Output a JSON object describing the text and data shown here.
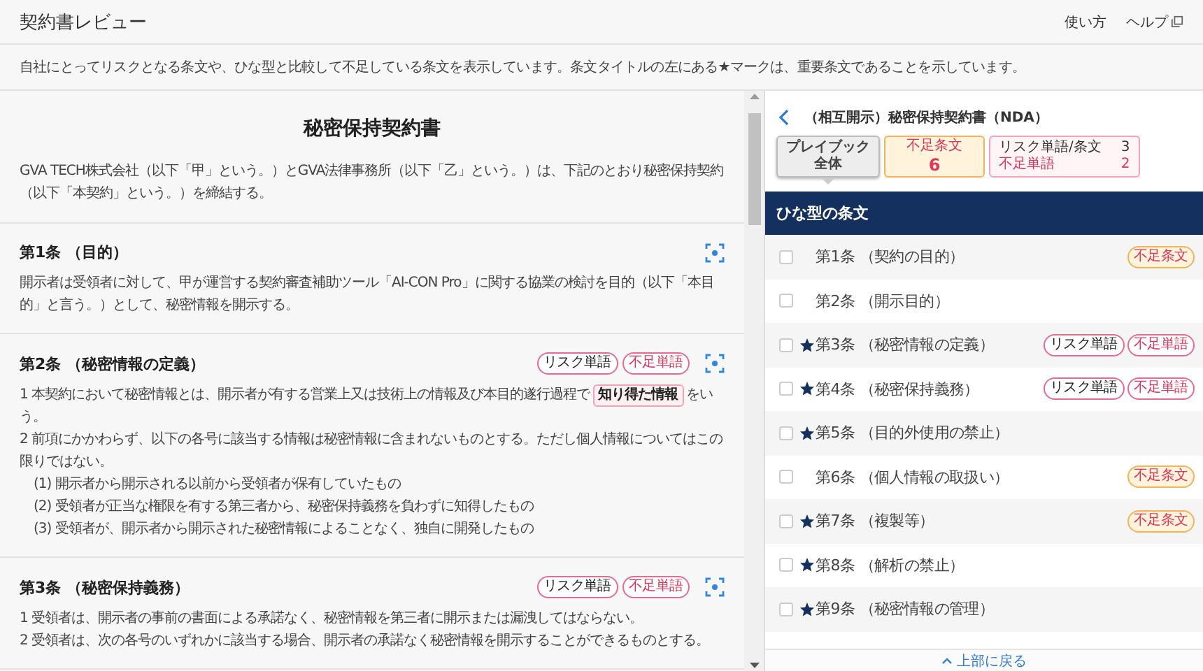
{
  "header": {
    "title": "契約書レビュー",
    "links": [
      {
        "label": "使い方",
        "external": false
      },
      {
        "label": "ヘルプ",
        "external": true
      }
    ]
  },
  "notice": "自社にとってリスクとなる条文や、ひな型と比較して不足している条文を表示しています。条文タイトルの左にある★マークは、重要条文であることを示しています。",
  "document": {
    "title": "秘密保持契約書",
    "preamble": "GVA TECH株式会社（以下「甲」という。）とGVA法律事務所（以下「乙」という。）は、下記のとおり秘密保持契約（以下「本契約」という。）を締結する。",
    "articles": [
      {
        "heading": "第1条 （目的）",
        "paragraphs": [
          {
            "kind": "clause",
            "parts": [
              {
                "text": "開示者は受領者に対して、甲が運営する契約審査補助ツール「AI-CON Pro」に関する協業の検討を目的（以下「本目的」と言う。）として、秘密情報を開示する。",
                "highlight": false
              }
            ]
          }
        ]
      },
      {
        "heading": "第2条 （秘密情報の定義）",
        "tags": [
          {
            "kind": "risk",
            "label": "リスク単語"
          },
          {
            "kind": "missing_word",
            "label": "不足単語"
          }
        ],
        "paragraphs": [
          {
            "kind": "clause",
            "parts": [
              {
                "text": "1 本契約において秘密情報とは、開示者が有する営業上又は技術上の情報及び本目的遂行過程で",
                "highlight": false
              },
              {
                "text": "知り得た情報",
                "highlight": true
              },
              {
                "text": "をいう。",
                "highlight": false
              }
            ]
          },
          {
            "kind": "clause",
            "parts": [
              {
                "text": "2 前項にかかわらず、以下の各号に該当する情報は秘密情報に含まれないものとする。ただし個人情報についてはこの限りではない。",
                "highlight": false
              }
            ]
          },
          {
            "kind": "item",
            "parts": [
              {
                "text": "(1) 開示者から開示される以前から受領者が保有していたもの",
                "highlight": false
              }
            ]
          },
          {
            "kind": "item",
            "parts": [
              {
                "text": "(2) 受領者が正当な権限を有する第三者から、秘密保持義務を負わずに知得したもの",
                "highlight": false
              }
            ]
          },
          {
            "kind": "item",
            "parts": [
              {
                "text": "(3) 受領者が、開示者から開示された秘密情報によることなく、独自に開発したもの",
                "highlight": false
              }
            ]
          }
        ]
      },
      {
        "heading": "第3条 （秘密保持義務）",
        "tags": [
          {
            "kind": "risk",
            "label": "リスク単語"
          },
          {
            "kind": "missing_word",
            "label": "不足単語"
          }
        ],
        "paragraphs": [
          {
            "kind": "clause",
            "parts": [
              {
                "text": "1 受領者は、開示者の事前の書面による承諾なく、秘密情報を第三者に開示または漏洩してはならない。",
                "highlight": false
              }
            ]
          },
          {
            "kind": "clause",
            "parts": [
              {
                "text": "2 受領者は、次の各号のいずれかに該当する場合、開示者の承諾なく秘密情報を開示することができるものとする。",
                "highlight": false
              }
            ]
          }
        ]
      }
    ]
  },
  "review": {
    "title": "（相互開示）秘密保持契約書（NDA）",
    "summary": [
      {
        "kind": "playbook",
        "lines": [
          "プレイブック",
          "全体"
        ],
        "selected": true
      },
      {
        "kind": "missing_clause",
        "lines": [
          "不足条文",
          "6"
        ],
        "selected": false
      },
      {
        "kind": "risk",
        "rows": [
          {
            "label": "リスク単語/条文",
            "count": "3",
            "kind": "risk"
          },
          {
            "label": "不足単語",
            "count": "2",
            "kind": "missing_word"
          }
        ],
        "selected": false
      }
    ],
    "section": "ひな型の条文",
    "items": [
      {
        "label": "第1条 （契約の目的）",
        "important": false,
        "checked": false,
        "tags": [
          {
            "kind": "missing_clause",
            "label": "不足条文"
          }
        ]
      },
      {
        "label": "第2条 （開示目的）",
        "important": false,
        "checked": false
      },
      {
        "label": "第3条 （秘密情報の定義）",
        "important": true,
        "checked": false,
        "tags": [
          {
            "kind": "risk",
            "label": "リスク単語"
          },
          {
            "kind": "missing_word",
            "label": "不足単語"
          }
        ]
      },
      {
        "label": "第4条 （秘密保持義務）",
        "important": true,
        "checked": false,
        "tags": [
          {
            "kind": "risk",
            "label": "リスク単語"
          },
          {
            "kind": "missing_word",
            "label": "不足単語"
          }
        ]
      },
      {
        "label": "第5条 （目的外使用の禁止）",
        "important": true,
        "checked": false
      },
      {
        "label": "第6条 （個人情報の取扱い）",
        "important": false,
        "checked": false,
        "tags": [
          {
            "kind": "missing_clause",
            "label": "不足条文"
          }
        ]
      },
      {
        "label": "第7条 （複製等）",
        "important": true,
        "checked": false,
        "tags": [
          {
            "kind": "missing_clause",
            "label": "不足条文"
          }
        ]
      },
      {
        "label": "第8条 （解析の禁止）",
        "important": true,
        "checked": false
      },
      {
        "label": "第9条 （秘密情報の管理）",
        "important": true,
        "checked": false
      }
    ],
    "back_to_top": "上部に戻る"
  }
}
